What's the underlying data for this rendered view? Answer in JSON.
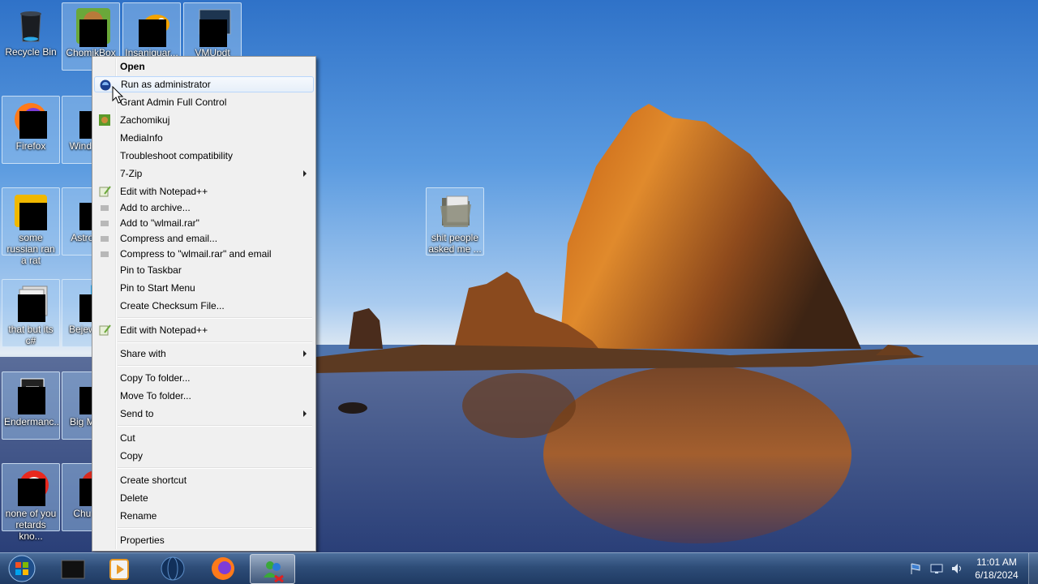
{
  "desktop": {
    "icons": [
      {
        "label": "Recycle Bin"
      },
      {
        "label": "ChomikBox"
      },
      {
        "label": "Insaniquar..."
      },
      {
        "label": "VMUpdt"
      },
      {
        "label": "Firefox"
      },
      {
        "label": "Wind Live"
      },
      {
        "label": "some russian ran a rat"
      },
      {
        "label": "Astro Del"
      },
      {
        "label": "that but its c#"
      },
      {
        "label": "Bejew Del"
      },
      {
        "label": "Endermanc..."
      },
      {
        "label": "Big M Del"
      },
      {
        "label": "none of you retards kno..."
      },
      {
        "label": "Chu Del"
      },
      {
        "label": "shit people asked me ..."
      }
    ]
  },
  "context_menu": {
    "items": [
      {
        "label": "Open",
        "bold": true
      },
      {
        "label": "Run as administrator",
        "icon": "shield-icon",
        "hover": true
      },
      {
        "label": "Grant Admin Full Control"
      },
      {
        "label": "Zachomikuj",
        "icon": "chomikbox-icon"
      },
      {
        "label": "MediaInfo"
      },
      {
        "label": "Troubleshoot compatibility"
      },
      {
        "label": "7-Zip",
        "submenu": true
      },
      {
        "label": "Edit with Notepad++",
        "icon": "notepad-icon"
      },
      {
        "label": "Add to archive...",
        "icon": "winrar-icon"
      },
      {
        "label": "Add to \"wlmail.rar\"",
        "icon": "winrar-icon"
      },
      {
        "label": "Compress and email...",
        "icon": "winrar-icon"
      },
      {
        "label": "Compress to \"wlmail.rar\" and email",
        "icon": "winrar-icon"
      },
      {
        "label": "Pin to Taskbar"
      },
      {
        "label": "Pin to Start Menu"
      },
      {
        "label": "Create Checksum File..."
      },
      {
        "label": "Edit with Notepad++",
        "icon": "notepad-icon"
      },
      {
        "label": "Share with",
        "submenu": true
      },
      {
        "label": "Copy To folder..."
      },
      {
        "label": "Move To folder..."
      },
      {
        "label": "Send to",
        "submenu": true
      },
      {
        "label": "Cut"
      },
      {
        "label": "Copy"
      },
      {
        "label": "Create shortcut"
      },
      {
        "label": "Delete"
      },
      {
        "label": "Rename"
      },
      {
        "label": "Properties"
      }
    ]
  },
  "taskbar": {
    "clock_time": "11:01 AM",
    "clock_date": "6/18/2024",
    "apps": [
      "start-orb-icon",
      "terminal-icon",
      "media-player-icon",
      "globe-icon",
      "firefox-icon",
      "messenger-icon"
    ]
  },
  "colors": {
    "menu_bg": "#f0f0f0",
    "menu_hover": "#e6eff9",
    "taskbar": "#2e4d78",
    "sky": "#5b9be0"
  }
}
